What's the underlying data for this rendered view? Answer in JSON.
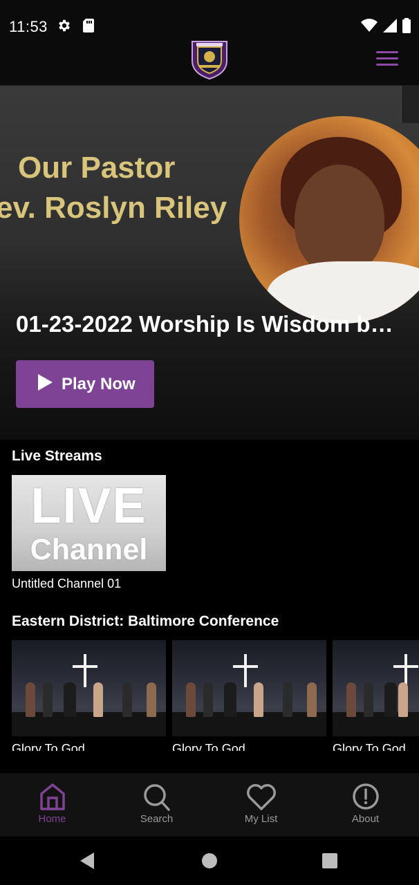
{
  "status_bar": {
    "time": "11:53",
    "icons": [
      "settings-gear-icon",
      "sd-card-icon",
      "wifi-icon",
      "cell-signal-icon",
      "battery-icon"
    ]
  },
  "header": {
    "logo": "church-crest-logo",
    "menu_icon": "hamburger-menu-icon",
    "accent_color": "#8a4aa5"
  },
  "hero": {
    "banner_line1": "Our Pastor",
    "banner_line2": "ev. Roslyn Riley",
    "title": "01-23-2022 Worship Is Wisdom by…",
    "play_label": "Play Now",
    "play_button_color": "#7f4395"
  },
  "live_streams": {
    "title": "Live Streams",
    "items": [
      {
        "thumb_big": "LIVE",
        "thumb_small": "Channel",
        "caption": "Untitled Channel 01"
      }
    ]
  },
  "eastern_district": {
    "title": "Eastern District: Baltimore Conference",
    "items": [
      {
        "caption": "Glory To God"
      },
      {
        "caption": "Glory To God"
      },
      {
        "caption": "Glory To God"
      }
    ]
  },
  "bottom_nav": {
    "items": [
      {
        "label": "Home",
        "icon": "home-icon",
        "active": true
      },
      {
        "label": "Search",
        "icon": "search-icon",
        "active": false
      },
      {
        "label": "My List",
        "icon": "heart-icon",
        "active": false
      },
      {
        "label": "About",
        "icon": "info-icon",
        "active": false
      }
    ],
    "active_color": "#7f4395",
    "inactive_color": "#9a9a9a"
  },
  "system_nav": {
    "buttons": [
      "back-icon",
      "home-circle-icon",
      "recents-icon"
    ]
  }
}
